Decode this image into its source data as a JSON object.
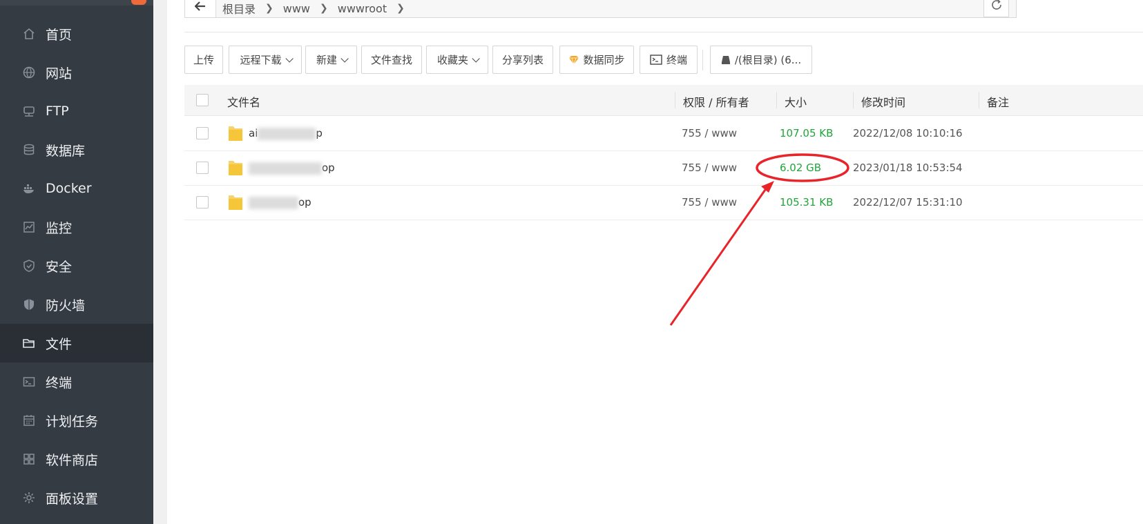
{
  "sidebar": {
    "items": [
      {
        "label": "首页",
        "icon": "home-icon"
      },
      {
        "label": "网站",
        "icon": "globe-icon"
      },
      {
        "label": "FTP",
        "icon": "ftp-icon"
      },
      {
        "label": "数据库",
        "icon": "database-icon"
      },
      {
        "label": "Docker",
        "icon": "docker-icon"
      },
      {
        "label": "监控",
        "icon": "monitor-icon"
      },
      {
        "label": "安全",
        "icon": "shield-icon"
      },
      {
        "label": "防火墙",
        "icon": "firewall-icon"
      },
      {
        "label": "文件",
        "icon": "folder-icon",
        "active": true
      },
      {
        "label": "终端",
        "icon": "terminal-icon"
      },
      {
        "label": "计划任务",
        "icon": "calendar-icon"
      },
      {
        "label": "软件商店",
        "icon": "apps-icon"
      },
      {
        "label": "面板设置",
        "icon": "gear-icon"
      }
    ]
  },
  "path": {
    "crumbs": [
      "根目录",
      "www",
      "wwwroot"
    ]
  },
  "toolbar": {
    "upload": "上传",
    "remote_download": "远程下载",
    "new": "新建",
    "file_search": "文件查找",
    "favorites": "收藏夹",
    "share_list": "分享列表",
    "data_sync": "数据同步",
    "terminal": "终端",
    "disk": "/(根目录) (6..."
  },
  "table": {
    "headers": {
      "name": "文件名",
      "perm": "权限 / 所有者",
      "size": "大小",
      "mtime": "修改时间",
      "note": "备注"
    },
    "rows": [
      {
        "name_prefix": "ai",
        "name_suffix": "p",
        "perm": "755 / www",
        "size": "107.05 KB",
        "mtime": "2022/12/08 10:10:16"
      },
      {
        "name_prefix": "",
        "name_suffix": "op",
        "perm": "755 / www",
        "size": "6.02 GB",
        "mtime": "2023/01/18 10:53:54"
      },
      {
        "name_prefix": "",
        "name_suffix": "op",
        "perm": "755 / www",
        "size": "105.31 KB",
        "mtime": "2022/12/07 15:31:10"
      }
    ]
  },
  "colors": {
    "sidebar_bg": "#353b43",
    "active_bg": "#2a2f35",
    "size_green": "#20a53a",
    "annotation_red": "#e8242a"
  }
}
